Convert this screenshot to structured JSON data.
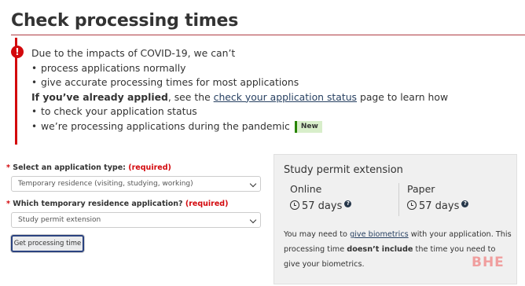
{
  "page": {
    "title": "Check processing times"
  },
  "alert": {
    "icon": "exclamation-icon",
    "intro": "Due to the impacts of COVID-19, we can’t",
    "bullets_1": [
      "process applications normally",
      "give accurate processing times for most applications"
    ],
    "applied_bold": "If you’ve already applied",
    "applied_mid": ", see the ",
    "applied_link": "check your application status",
    "applied_end": " page to learn how",
    "bullets_2": [
      "to check your application status",
      "we’re processing applications during the pandemic"
    ],
    "new_badge": "New"
  },
  "form": {
    "type_label": {
      "star": "*",
      "text": " Select an application type: ",
      "required": "(required)"
    },
    "type_value": "Temporary residence (visiting, studying, working)",
    "which_label": {
      "star": "*",
      "text": " Which temporary residence application? ",
      "required": "(required)"
    },
    "which_value": "Study permit extension",
    "submit_label": "Get processing time"
  },
  "result": {
    "heading": "Study permit extension",
    "online_label": "Online",
    "online_value": "57 days",
    "paper_label": "Paper",
    "paper_value": "57 days",
    "info_glyph": "?",
    "note_start": "You may need to ",
    "note_link": "give biometrics",
    "note_mid": " with your application. This processing time ",
    "note_bold": "doesn’t include",
    "note_end": " the time you need to give your biometrics."
  },
  "watermark": "BHE",
  "colors": {
    "accent_red": "#af3c43",
    "alert_red": "#d3080c",
    "link_blue": "#284162",
    "badge_green": "#278400",
    "panel_bg": "#f0f0f0"
  }
}
